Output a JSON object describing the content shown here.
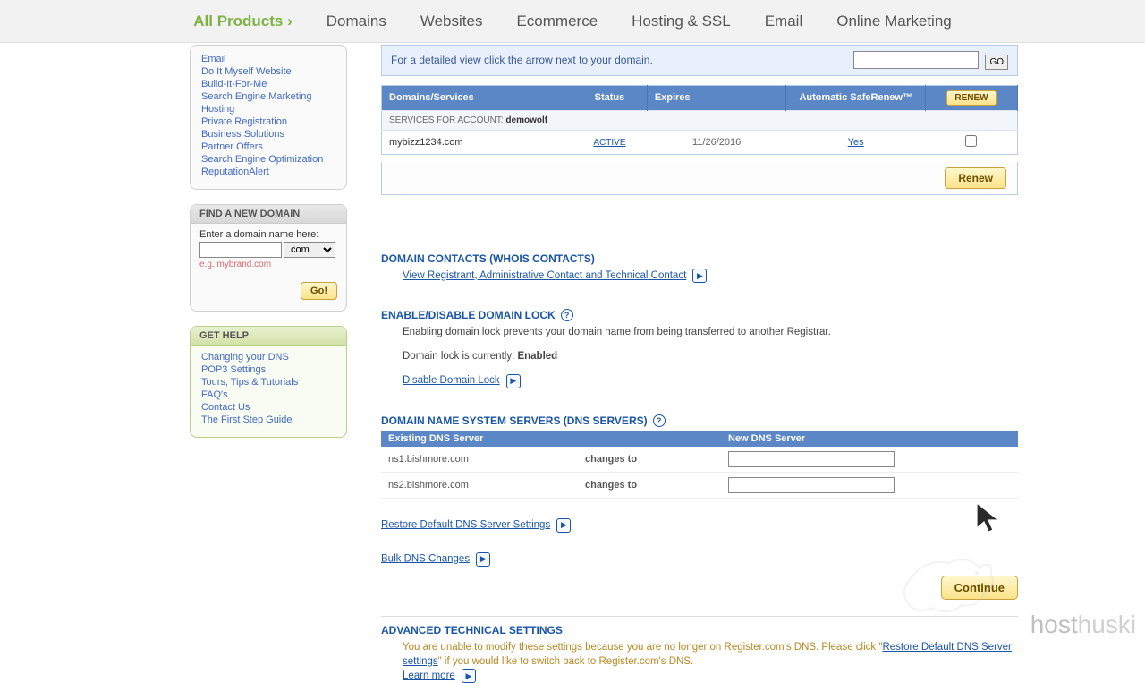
{
  "nav": {
    "all_products": "All Products",
    "domains": "Domains",
    "websites": "Websites",
    "ecommerce": "Ecommerce",
    "hosting_ssl": "Hosting & SSL",
    "email": "Email",
    "online_marketing": "Online Marketing"
  },
  "sidebar": {
    "links": [
      "Email",
      "Do It Myself Website",
      "Build-It-For-Me",
      "Search Engine Marketing",
      "Hosting",
      "Private Registration",
      "Business Solutions",
      "Partner Offers",
      "Search Engine Optimization",
      "ReputationAlert"
    ]
  },
  "find_domain": {
    "title": "FIND A NEW DOMAIN",
    "label": "Enter a domain name here:",
    "tld": ".com",
    "example": "e.g. mybrand.com",
    "go": "Go!"
  },
  "get_help": {
    "title": "GET HELP",
    "links": [
      "Changing your DNS",
      "POP3 Settings",
      "Tours, Tips & Tutorials",
      "FAQ's",
      "Contact Us",
      "The First Step Guide"
    ]
  },
  "notice": {
    "text": "For a detailed view click the arrow next to your domain.",
    "go": "GO"
  },
  "dom_table": {
    "headers": {
      "services": "Domains/Services",
      "status": "Status",
      "expires": "Expires",
      "saferenew": "Automatic SafeRenew™",
      "renew": "RENEW"
    },
    "account_label": "SERVICES FOR ACCOUNT:",
    "account_name": "demowolf",
    "row": {
      "domain": "mybizz1234.com",
      "status": "ACTIVE",
      "expires": "11/26/2016",
      "saferenew": "Yes"
    },
    "renew_btn": "Renew"
  },
  "contacts": {
    "title": "DOMAIN CONTACTS (WHOIS CONTACTS)",
    "link": "View Registrant, Administrative Contact and Technical Contact"
  },
  "lock": {
    "title": "ENABLE/DISABLE DOMAIN LOCK",
    "desc": "Enabling domain lock prevents your domain name from being transferred to another Registrar.",
    "current_label": "Domain lock is currently:",
    "current_value": "Enabled",
    "action": "Disable Domain Lock"
  },
  "dns": {
    "title": "DOMAIN NAME SYSTEM SERVERS (DNS SERVERS)",
    "headers": {
      "existing": "Existing DNS Server",
      "new": "New DNS Server"
    },
    "rows": [
      {
        "existing": "ns1.bishmore.com",
        "changes": "changes to"
      },
      {
        "existing": "ns2.bishmore.com",
        "changes": "changes to"
      }
    ],
    "restore": "Restore Default DNS Server Settings",
    "bulk": "Bulk DNS Changes",
    "continue": "Continue"
  },
  "adv": {
    "title": "ADVANCED TECHNICAL SETTINGS",
    "text_before": "You are unable to modify these settings because you are no longer on Register.com's DNS. Please click \"",
    "link": "Restore Default DNS Server settings",
    "text_after": "\" if you would like to switch back to Register.com's DNS.",
    "learn": "Learn more"
  },
  "watermark": {
    "brand": "hosthuski"
  }
}
